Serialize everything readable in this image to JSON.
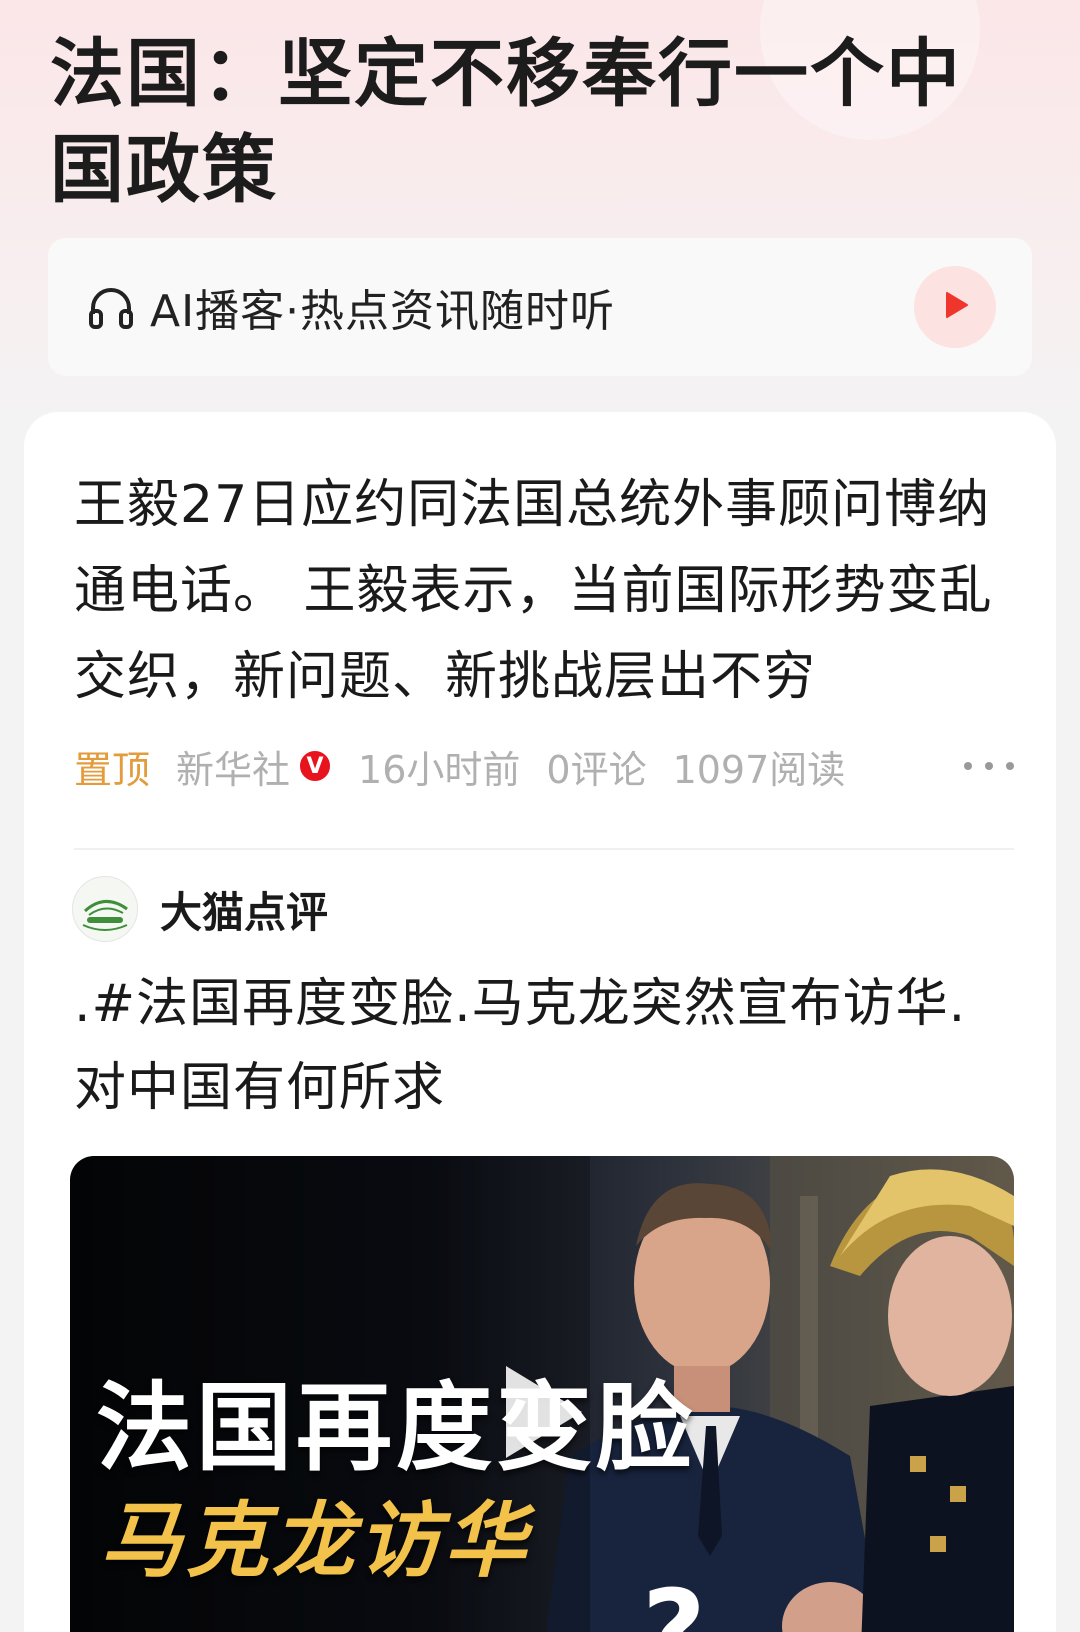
{
  "topic": {
    "title": "法国：坚定不移奉行一个中国政策"
  },
  "podcast": {
    "label": "AI播客·热点资讯随时听",
    "headphones_icon": "headphones-icon",
    "play_icon": "play-icon",
    "accent_color": "#f0352d"
  },
  "pinned_article": {
    "text": "王毅27日应约同法国总统外事顾问博纳通电话。 王毅表示，当前国际形势变乱交织，新问题、新挑战层出不穷",
    "pin_label": "置顶",
    "source": "新华社",
    "verified_badge": "V",
    "time": "16小时前",
    "comments": "0评论",
    "reads": "1097阅读"
  },
  "post": {
    "author": "大猫点评",
    "text": ".#法国再度变脸.马克龙突然宣布访华.对中国有何所求",
    "video": {
      "cover_line1": "法国再度变脸",
      "cover_line2": "马克龙访华",
      "cover_mark": "?"
    }
  }
}
